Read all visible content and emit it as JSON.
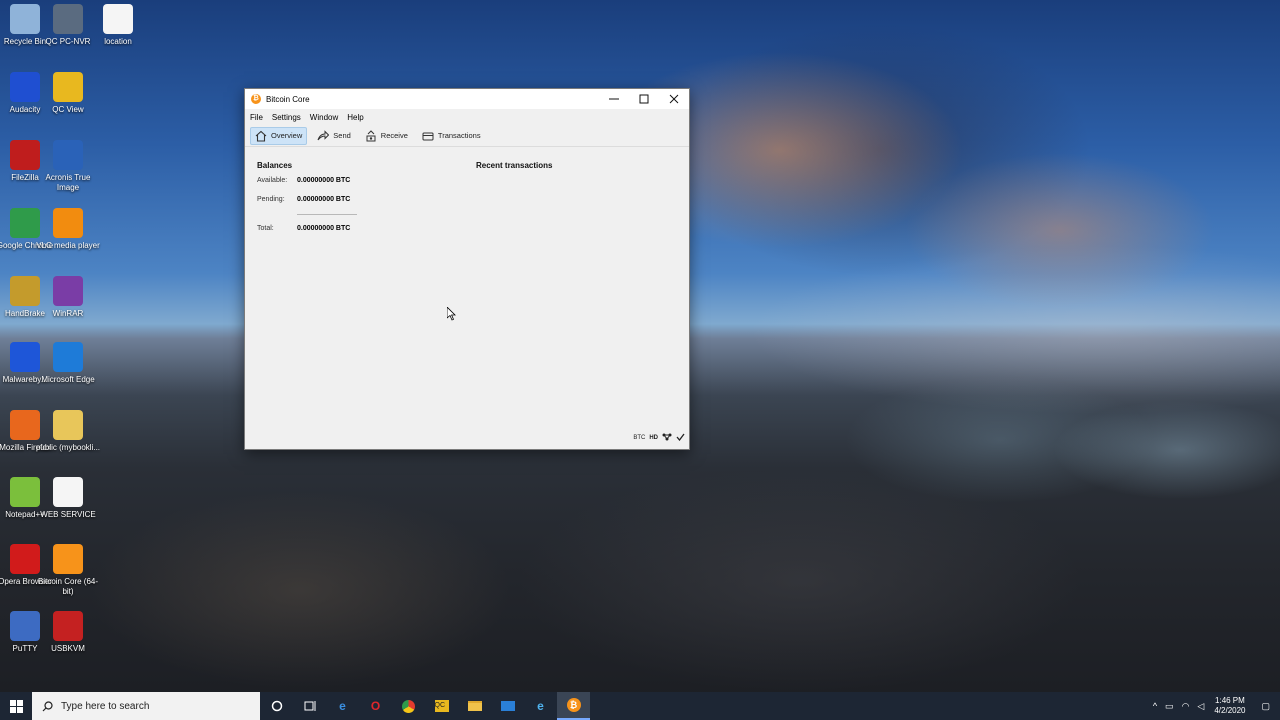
{
  "desktop": {
    "icons": [
      {
        "label": "Recycle Bin",
        "icon": "recycle-bin-icon",
        "color": "#8fb3d9"
      },
      {
        "label": "QC PC-NVR",
        "icon": "nvr-icon",
        "color": "#5a6b80"
      },
      {
        "label": "location",
        "icon": "document-icon",
        "color": "#f5f5f5"
      },
      {
        "label": "Audacity",
        "icon": "audacity-icon",
        "color": "#1f4fd1"
      },
      {
        "label": "QC View",
        "icon": "qc-view-icon",
        "color": "#e8b81f"
      },
      {
        "label": "FileZilla",
        "icon": "filezilla-icon",
        "color": "#bf1d1d"
      },
      {
        "label": "Acronis True Image",
        "icon": "acronis-icon",
        "color": "#2a62b8"
      },
      {
        "label": "Google Chrome",
        "icon": "chrome-icon",
        "color": "#2f9b4a"
      },
      {
        "label": "VLC media player",
        "icon": "vlc-icon",
        "color": "#f28c0f"
      },
      {
        "label": "HandBrake",
        "icon": "handbrake-icon",
        "color": "#c49b2c"
      },
      {
        "label": "WinRAR",
        "icon": "winrar-icon",
        "color": "#7a3da6"
      },
      {
        "label": "Malwareby...",
        "icon": "malwarebytes-icon",
        "color": "#1e56d8"
      },
      {
        "label": "Microsoft Edge",
        "icon": "edge-icon",
        "color": "#1e7bd8"
      },
      {
        "label": "Mozilla Firefox",
        "icon": "firefox-icon",
        "color": "#e8671d"
      },
      {
        "label": "public (mybookli...",
        "icon": "folder-icon",
        "color": "#e8c65a"
      },
      {
        "label": "Notepad++",
        "icon": "notepadpp-icon",
        "color": "#7bbf3c"
      },
      {
        "label": "WEB SERVICE",
        "icon": "web-service-icon",
        "color": "#f5f5f5"
      },
      {
        "label": "Opera Browser",
        "icon": "opera-icon",
        "color": "#d11b1b"
      },
      {
        "label": "Bitcoin Core (64-bit)",
        "icon": "bitcoin-icon",
        "color": "#f7931a"
      },
      {
        "label": "PuTTY",
        "icon": "putty-icon",
        "color": "#3d6bc2"
      },
      {
        "label": "USBKVM",
        "icon": "usbkvm-icon",
        "color": "#c42121"
      }
    ]
  },
  "window": {
    "title": "Bitcoin Core",
    "menu": [
      "File",
      "Settings",
      "Window",
      "Help"
    ],
    "toolbar": {
      "overview": "Overview",
      "send": "Send",
      "receive": "Receive",
      "transactions": "Transactions"
    },
    "balances": {
      "title": "Balances",
      "available_label": "Available:",
      "available_value": "0.00000000 BTC",
      "pending_label": "Pending:",
      "pending_value": "0.00000000 BTC",
      "total_label": "Total:",
      "total_value": "0.00000000 BTC"
    },
    "recent_transactions_title": "Recent transactions",
    "status": {
      "unit": "BTC",
      "hd": "HD"
    },
    "accent": "#f7931a"
  },
  "taskbar": {
    "search_placeholder": "Type here to search",
    "time": "1:46 PM",
    "date": "4/2/2020",
    "colors": {
      "background": "#1d2634",
      "search": "#f2f2f2"
    }
  }
}
